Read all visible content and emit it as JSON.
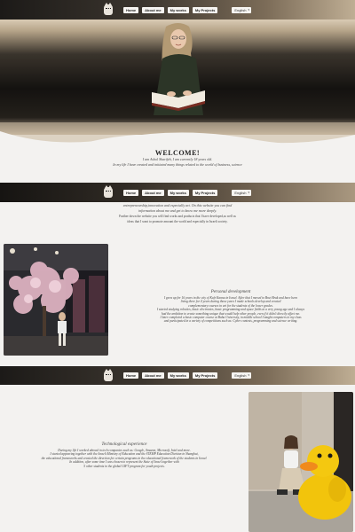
{
  "nav": {
    "links": [
      "Home",
      "About me",
      "My works",
      "My Projects"
    ],
    "language": "English"
  },
  "welcome": {
    "title": "WELCOME!",
    "lines": [
      "I am Ashol Sharifeh, I am currently 18 years old.",
      "In my life I have created and initiated many things related to the world of business, science"
    ]
  },
  "intro": {
    "lines": [
      "entrepreneurship,innovation and especially art. On this website you can find",
      "information about me and get to know me more deeply.",
      "Further down the website you will find works and products that I have developed,as well as",
      "ideas that I want to promote amount the world and especially in Israeli society."
    ]
  },
  "personal": {
    "heading": "Personal development",
    "lines": [
      "I grew up for 16 years in the city of Kafr Kanna in Israel. After that I moved to Bnei Brak and have been",
      "living there for 4 years during those years I made schools develop and created",
      "complementary courses in art for the students of the lower grades.",
      "I started studying robotics, basic electronics, basic programming and space fields at a very young age and I always",
      "had the ambition to create something unique that would help other people, even if it didn't directly affect me.",
      "I later completed a basic computer course at Baha University, in middle school I taught computers to my class",
      "and participated in a variety of competitions such as: Cyber contests, programming and science writing."
    ]
  },
  "tech": {
    "heading": "Technological experience",
    "lines": [
      "During my life I worked abroad in tech companies such as: Google, Amazon, Microsoft, Intel and more.",
      "I started appearing together with the Israeli Ministry of Education and the STEMP Education Division in Shanghai,",
      "the educational frameworks and created the direction for certain programs in the educational framework of the students in Israel.",
      "In addition, after some time I was chosen to represent the State of Israel together with",
      "5 other students in the global GIFT program for youth projects."
    ]
  },
  "colors": {
    "nav_dark": "#1c1a18",
    "nav_light": "#bfae94",
    "page_bg": "#f3f2f0"
  },
  "icons": [
    "owl-logo-icon",
    "chevron-down-icon"
  ]
}
